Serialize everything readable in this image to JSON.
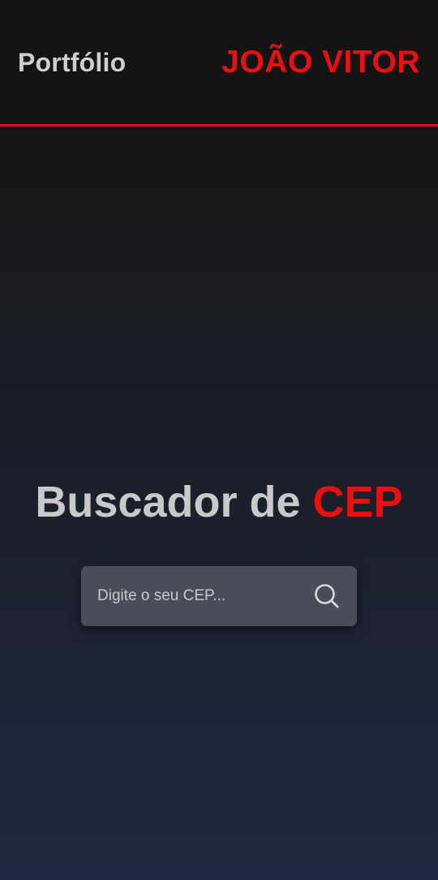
{
  "header": {
    "brand": "Portfólio",
    "owner": "JOÃO VITOR"
  },
  "hero": {
    "title_main": "Buscador de ",
    "title_accent": "CEP"
  },
  "search": {
    "placeholder": "Digite o seu CEP...",
    "value": "",
    "icon": "search-icon"
  },
  "colors": {
    "accent": "#f00d0d",
    "header_bg": "#141414",
    "text_muted": "#cfcfcf",
    "input_bg": "#4a4d57"
  }
}
